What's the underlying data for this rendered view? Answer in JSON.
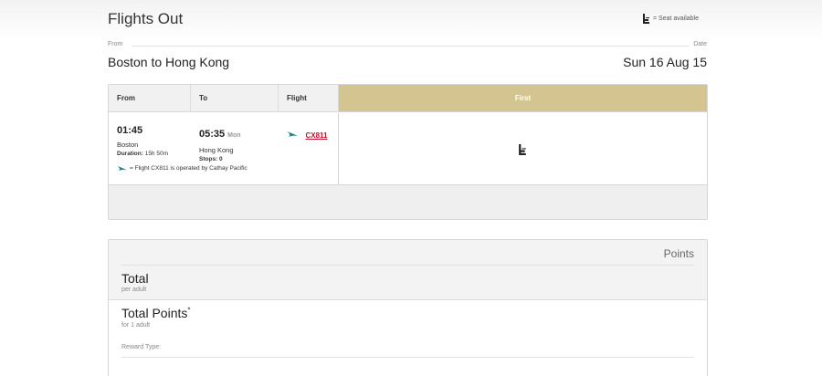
{
  "header": {
    "title": "Flights Out",
    "legend_text": "= Seat available",
    "legend_icon": "seat-icon"
  },
  "route": {
    "from_label": "From",
    "date_label": "Date",
    "route": "Boston to Hong Kong",
    "date": "Sun 16 Aug 15"
  },
  "table": {
    "col_from": "From",
    "col_to": "To",
    "col_flight": "Flight",
    "col_class": "First",
    "class_color": "#d4c48f",
    "row": {
      "depart_time": "01:45",
      "depart_city": "Boston",
      "duration_label": "Duration:",
      "duration": "15h 50m",
      "arrive_time": "05:35",
      "arrive_day": "Mon",
      "arrive_city": "Hong Kong",
      "stops_label": "Stops:",
      "stops": "0",
      "flight_number": "CX811",
      "seat_icon": "seat-icon"
    },
    "operated_note": "= Flight CX811 is operated by Cathay Pacific"
  },
  "points": {
    "header": "Points",
    "total_label": "Total",
    "total_sub": "per adult",
    "total_points_label": "Total Points",
    "total_points_mark": "*",
    "total_points_sub": "for 1 adult",
    "reward_type_label": "Reward Type:"
  },
  "colors": {
    "link": "#c8102e",
    "airline": "#1a8a8a"
  }
}
